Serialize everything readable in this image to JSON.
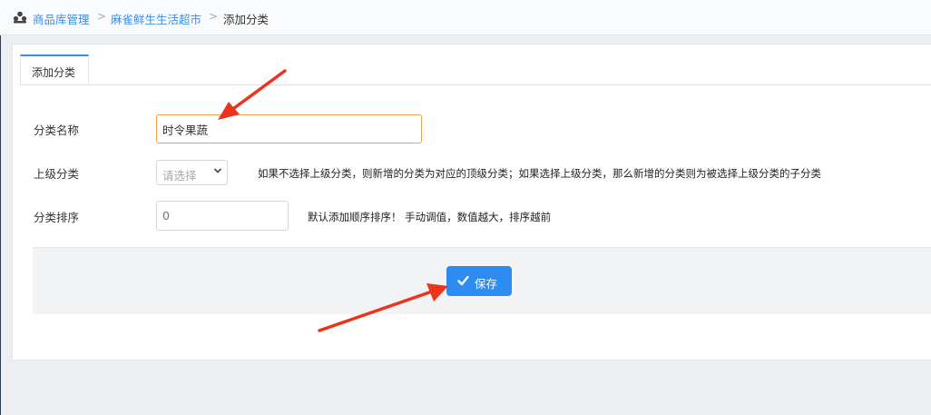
{
  "breadcrumb": {
    "icon": "users-icon",
    "items": [
      "商品库管理",
      "麻雀鲜生生活超市"
    ],
    "separator": ">",
    "current": "添加分类"
  },
  "tab": {
    "label": "添加分类"
  },
  "form": {
    "name_label": "分类名称",
    "name_value": "时令果蔬",
    "parent_label": "上级分类",
    "parent_selected": "请选择",
    "parent_hint": "如果不选择上级分类，则新增的分类为对应的顶级分类；如果选择上级分类，那么新增的分类则为被选择上级分类的子分类",
    "sort_label": "分类排序",
    "sort_placeholder": "0",
    "sort_hint": "默认添加顺序排序！ 手动调值，数值越大，排序越前"
  },
  "save_button": {
    "label": "保存",
    "icon": "check-icon"
  },
  "colors": {
    "accent": "#2d8cf0",
    "link": "#3a8ee6",
    "annotation": "#e8351c",
    "focus_border": "#f0a04e"
  }
}
